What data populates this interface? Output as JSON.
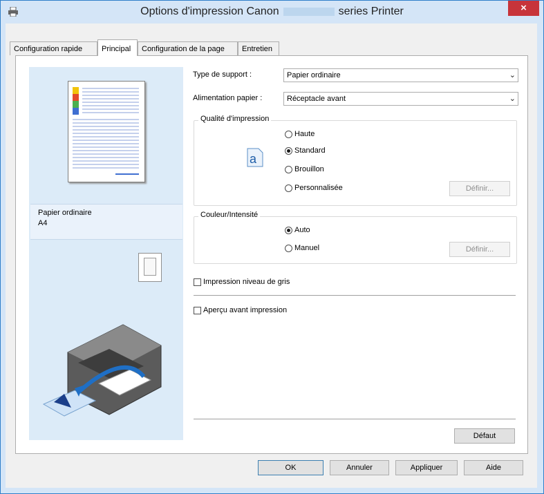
{
  "window": {
    "title_left": "Options d'impression Canon",
    "title_right": "series Printer",
    "close_label": "×"
  },
  "tabs": [
    {
      "label": "Configuration rapide"
    },
    {
      "label": "Principal"
    },
    {
      "label": "Configuration de la page"
    },
    {
      "label": "Entretien"
    }
  ],
  "preview": {
    "media_line": "Papier ordinaire",
    "size_line": "A4"
  },
  "media_type": {
    "label": "Type de support :",
    "value": "Papier ordinaire"
  },
  "paper_source": {
    "label": "Alimentation papier :",
    "value": "Réceptacle avant"
  },
  "print_quality": {
    "title": "Qualité d'impression",
    "options": [
      "Haute",
      "Standard",
      "Brouillon",
      "Personnalisée"
    ],
    "selected": "Standard",
    "define_label": "Définir..."
  },
  "color_intensity": {
    "title": "Couleur/Intensité",
    "options": [
      "Auto",
      "Manuel"
    ],
    "selected": "Auto",
    "define_label": "Définir..."
  },
  "grayscale": {
    "label": "Impression niveau de gris",
    "checked": false
  },
  "preview_before_print": {
    "label": "Aperçu avant impression",
    "checked": false
  },
  "buttons": {
    "defaults": "Défaut",
    "ok": "OK",
    "cancel": "Annuler",
    "apply": "Appliquer",
    "help": "Aide"
  },
  "colors": {
    "accent": "#2f7fc9",
    "close": "#c7343a",
    "preview_bg": "#dcebf8"
  }
}
